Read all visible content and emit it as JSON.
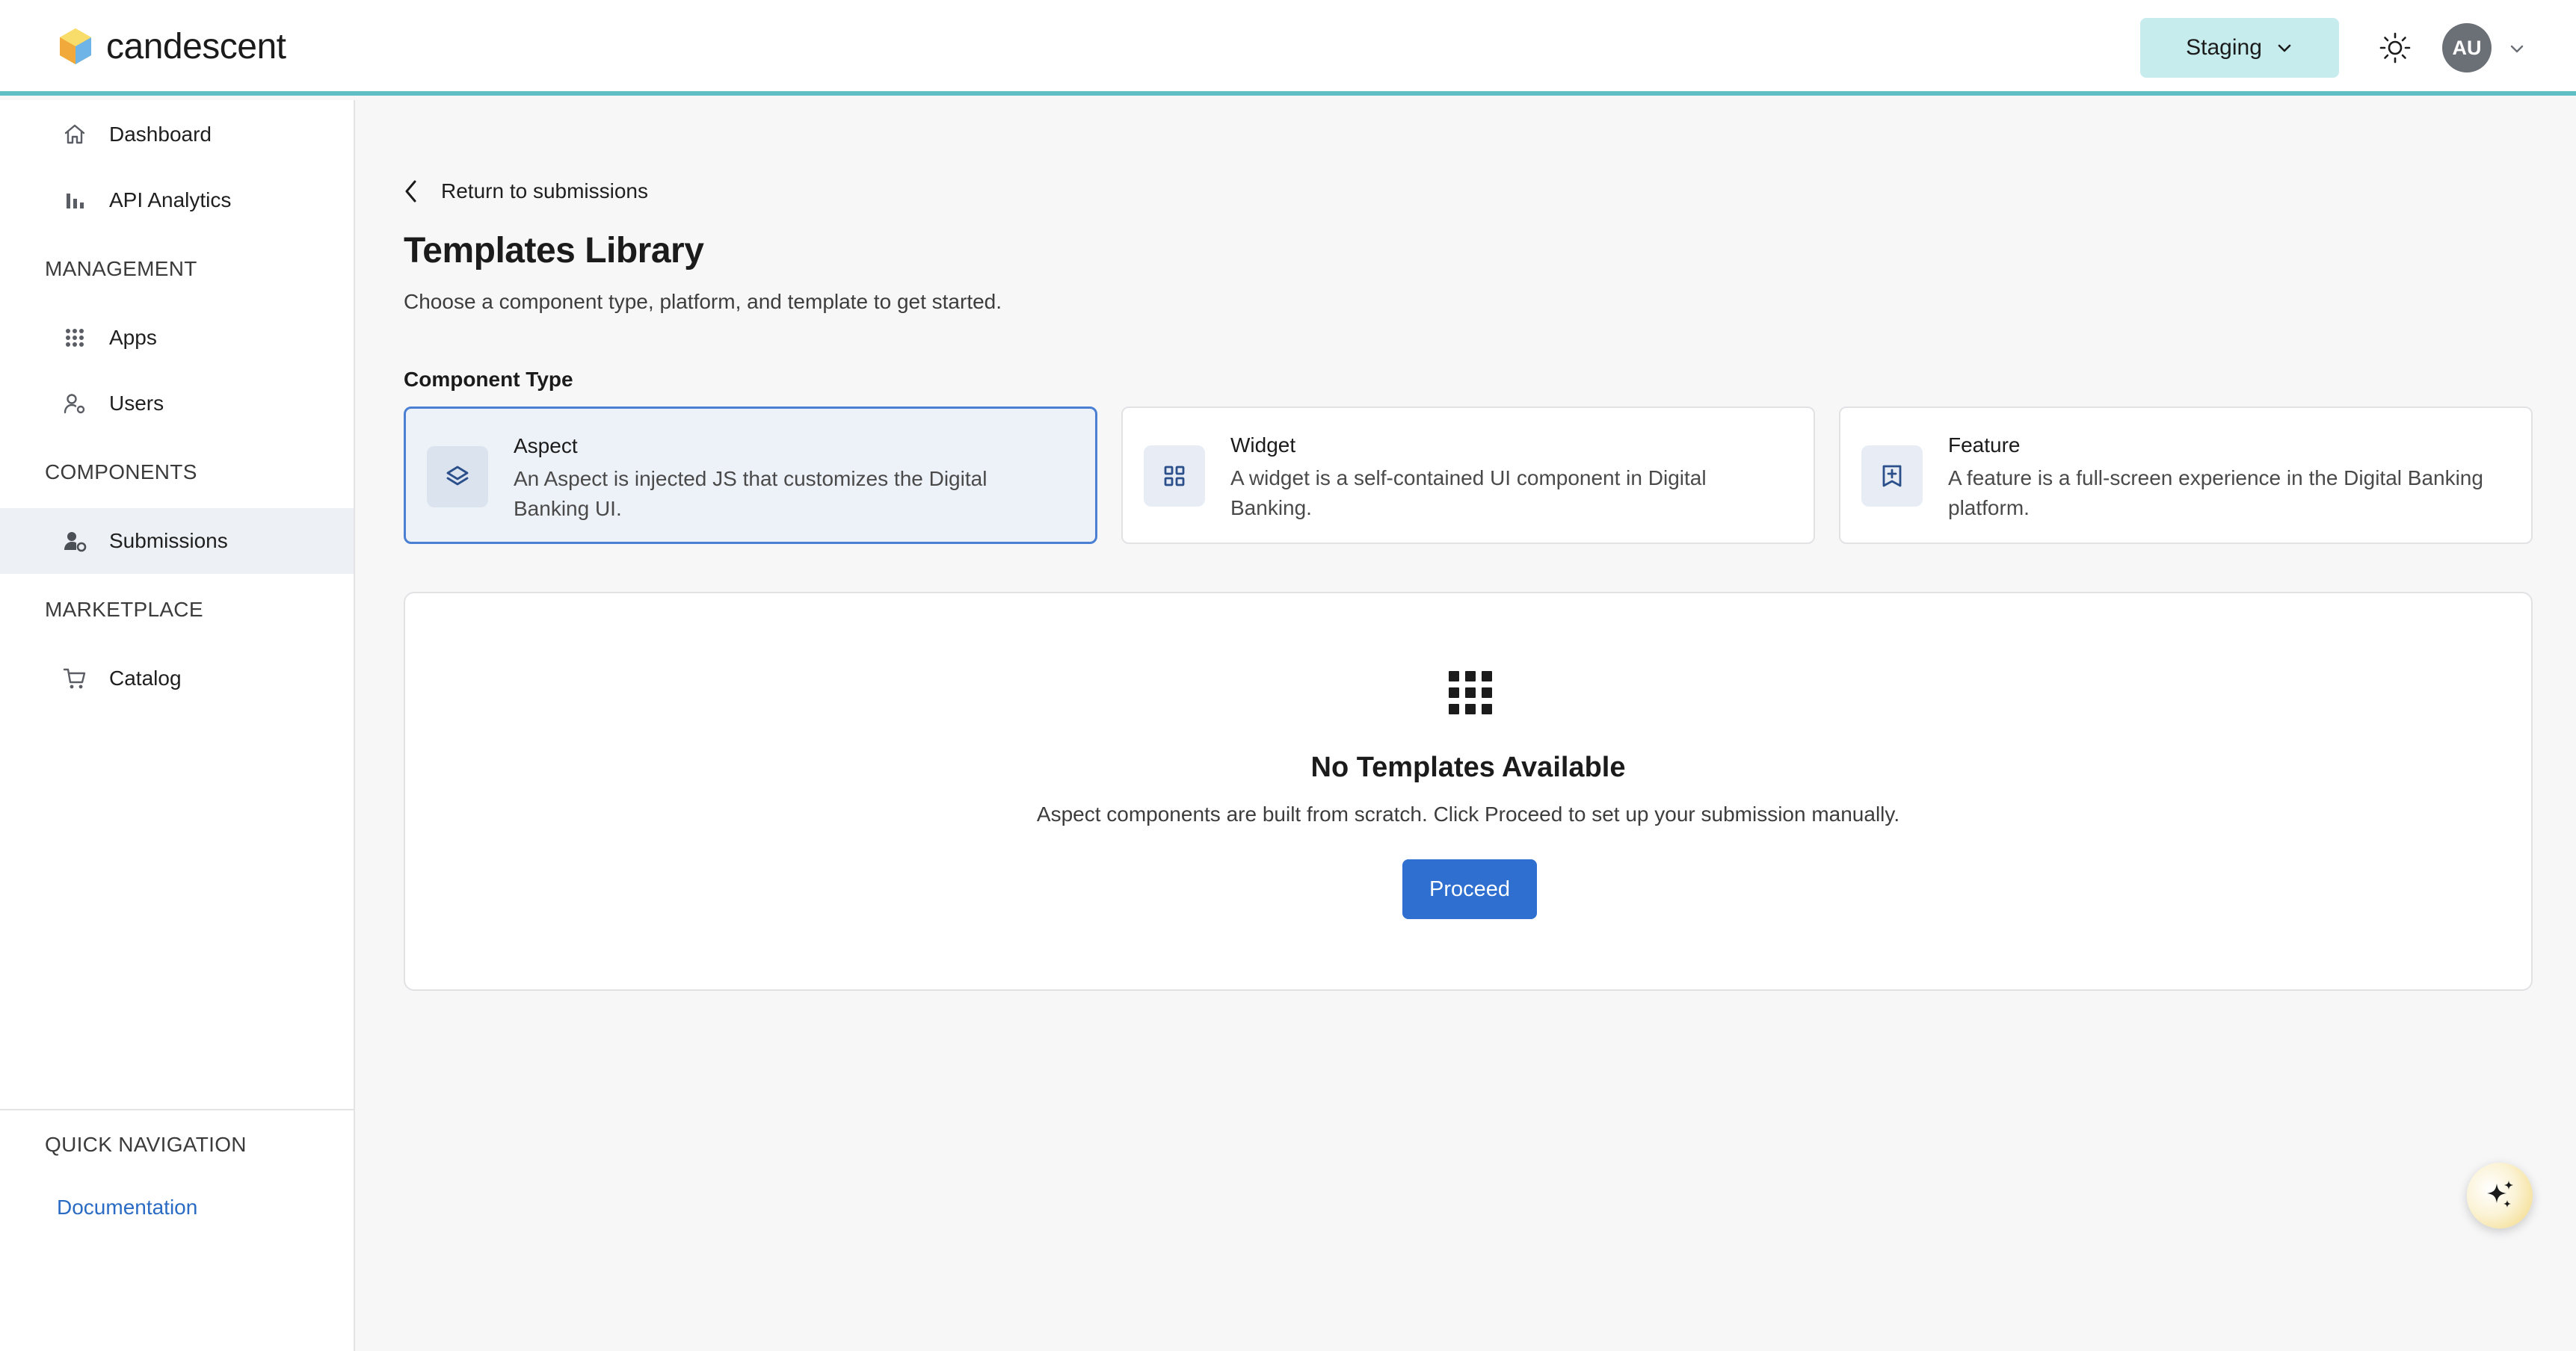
{
  "header": {
    "brand": "candescent",
    "environment": "Staging",
    "avatar_initials": "AU"
  },
  "sidebar": {
    "top_items": [
      {
        "label": "Dashboard",
        "icon": "home-icon"
      },
      {
        "label": "API Analytics",
        "icon": "bar-chart-icon"
      }
    ],
    "sections": [
      {
        "label": "MANAGEMENT",
        "items": [
          {
            "label": "Apps",
            "icon": "grid-icon"
          },
          {
            "label": "Users",
            "icon": "user-settings-icon"
          }
        ]
      },
      {
        "label": "COMPONENTS",
        "items": [
          {
            "label": "Submissions",
            "icon": "user-gear-icon",
            "active": true
          }
        ]
      },
      {
        "label": "MARKETPLACE",
        "items": [
          {
            "label": "Catalog",
            "icon": "cart-icon"
          }
        ]
      }
    ],
    "quick_nav": {
      "label": "QUICK NAVIGATION",
      "documentation": "Documentation"
    }
  },
  "main": {
    "back_link": "Return to submissions",
    "title": "Templates Library",
    "subtitle": "Choose a component type, platform, and template to get started.",
    "component_type_heading": "Component Type",
    "component_types": [
      {
        "name": "Aspect",
        "description": "An Aspect is injected JS that customizes the Digital Banking UI.",
        "icon": "layers-icon",
        "selected": true
      },
      {
        "name": "Widget",
        "description": "A widget is a self-contained UI component in Digital Banking.",
        "icon": "widget-grid-icon",
        "selected": false
      },
      {
        "name": "Feature",
        "description": "A feature is a full-screen experience in the Digital Banking platform.",
        "icon": "feature-plus-icon",
        "selected": false
      }
    ],
    "empty_state": {
      "title": "No Templates Available",
      "description": "Aspect components are built from scratch. Click Proceed to set up your submission manually.",
      "button": "Proceed",
      "icon": "apps-grid-icon"
    }
  },
  "colors": {
    "accent": "#2f6fd0",
    "header_rule": "#5fbfc4",
    "environment_bg": "#c6ecee",
    "selected_border": "#4a7fd4"
  }
}
